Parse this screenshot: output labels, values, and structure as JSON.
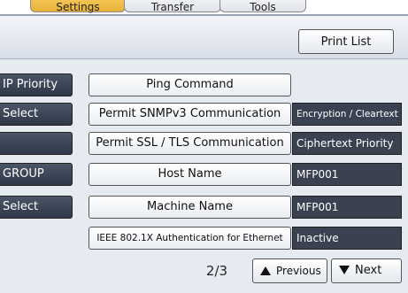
{
  "tabs": [
    {
      "label": "Settings"
    },
    {
      "label": "Transfer"
    },
    {
      "label": "Tools"
    }
  ],
  "header": {
    "print_list": "Print List"
  },
  "rows": [
    {
      "left": "IP Priority",
      "mid": "Ping Command",
      "value": ""
    },
    {
      "left": "Select",
      "mid": "Permit SNMPv3 Communication",
      "value": "Encryption / Cleartext"
    },
    {
      "left": "",
      "mid": "Permit SSL / TLS Communication",
      "value": "Ciphertext Priority"
    },
    {
      "left": "GROUP",
      "mid": "Host Name",
      "value": "MFP001"
    },
    {
      "left": "Select",
      "mid": "Machine Name",
      "value": "MFP001"
    },
    {
      "left": "",
      "mid": "IEEE 802.1X Authentication for Ethernet",
      "value": "Inactive"
    }
  ],
  "pager": {
    "indicator": "2/3",
    "previous": "Previous",
    "next": "Next"
  }
}
